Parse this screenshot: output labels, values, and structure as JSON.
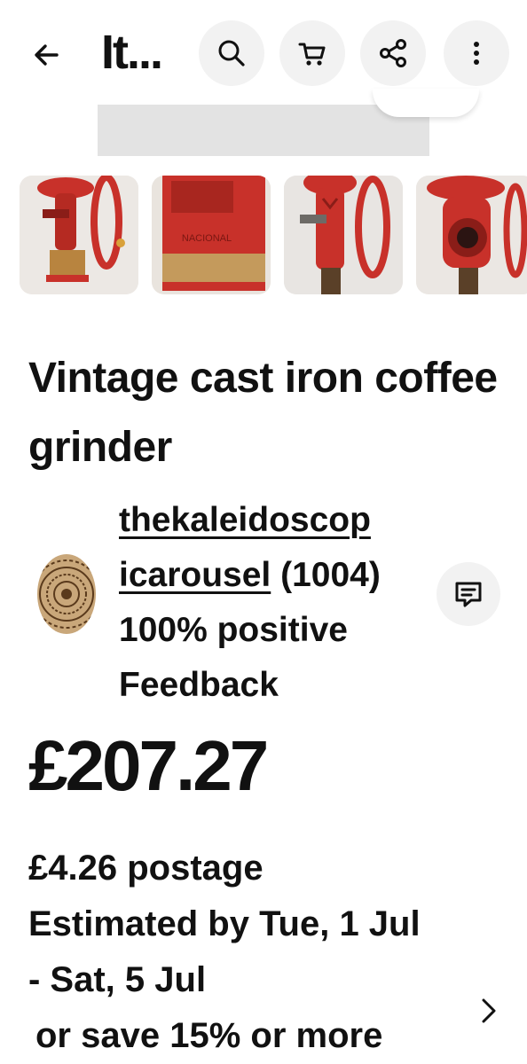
{
  "header": {
    "title": "It...",
    "icons": {
      "back": "back-arrow-icon",
      "search": "search-icon",
      "cart": "cart-icon",
      "share": "share-icon",
      "more": "more-vertical-icon"
    }
  },
  "gallery": {
    "thumbnails": [
      {
        "label": "grinder-side-view"
      },
      {
        "label": "grinder-base-closeup"
      },
      {
        "label": "grinder-front-view"
      },
      {
        "label": "grinder-top-view"
      }
    ]
  },
  "product": {
    "title": "Vintage cast iron coffee grinder"
  },
  "seller": {
    "name_line1": "thekaleidoscop",
    "name_line2": "icarousel",
    "count": "(1004)",
    "feedback_line1": "100% positive",
    "feedback_line2": "Feedback",
    "message_icon": "message-icon"
  },
  "price": {
    "amount": "£207.27"
  },
  "postage": {
    "cost": "£4.26 postage",
    "estimate_line1": "Estimated by Tue, 1 Jul",
    "estimate_line2": "- Sat, 5 Jul",
    "save": "or save 15% or more"
  },
  "colors": {
    "accent_red": "#c8312a",
    "button_bg": "#f2f2f2"
  }
}
